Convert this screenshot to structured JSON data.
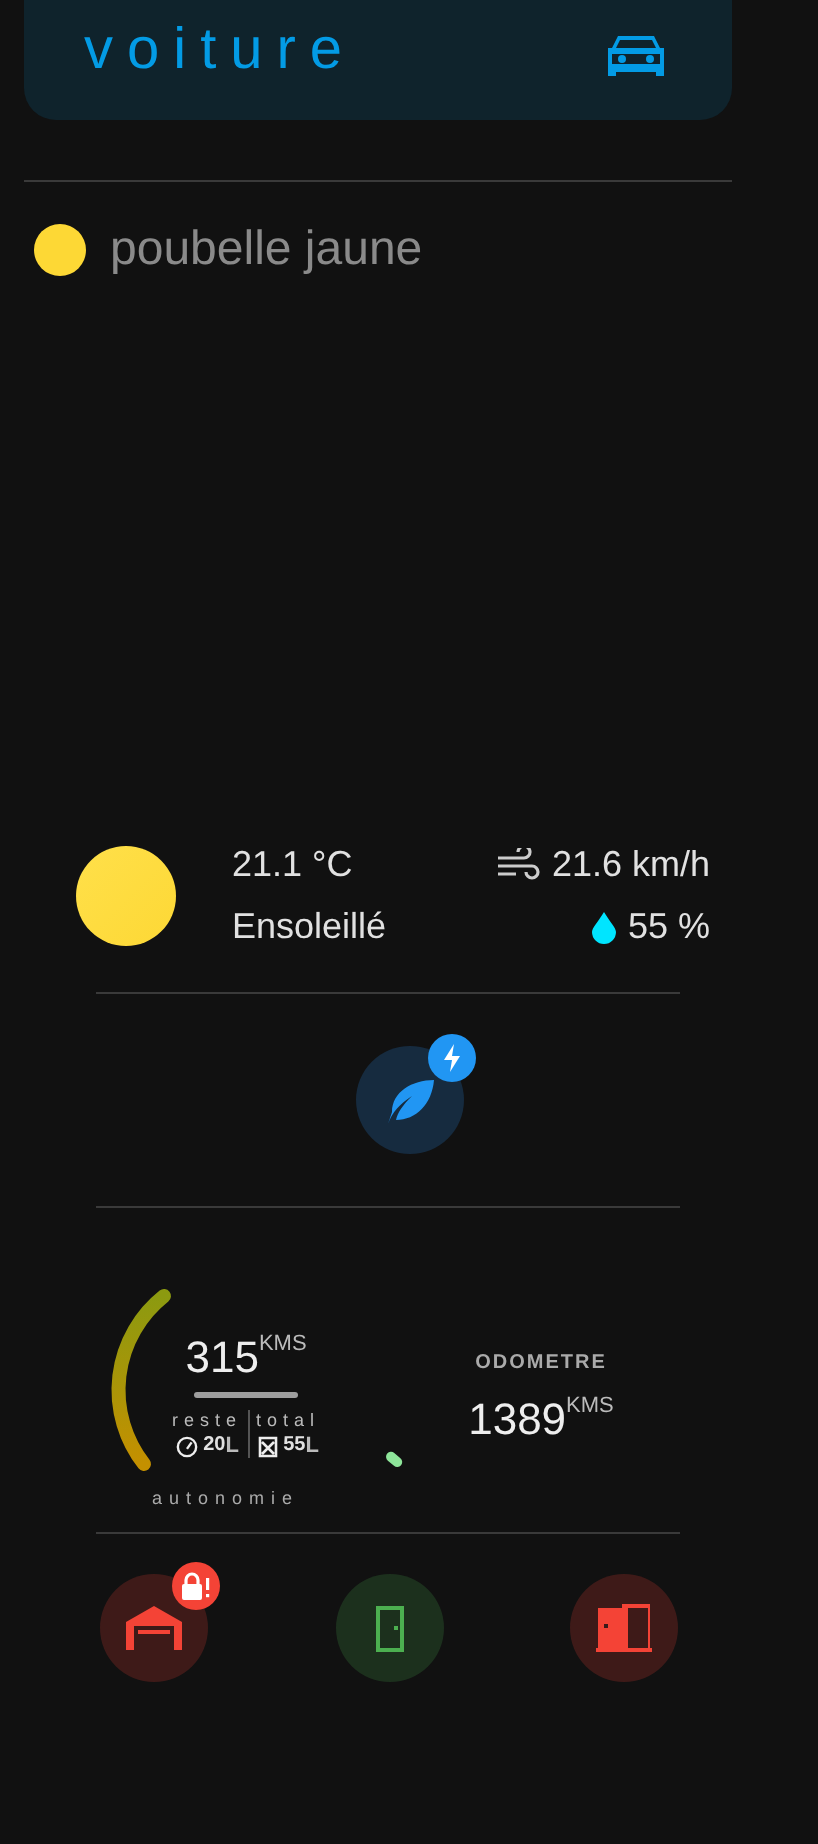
{
  "header": {
    "title": "voiture"
  },
  "reminders": [
    {
      "label": "poubelle jaune",
      "color": "#fdd835"
    }
  ],
  "weather": {
    "temperature": "21.1 °C",
    "condition": "Ensoleillé",
    "wind": "21.6 km/h",
    "humidity": "55 %"
  },
  "eco_button": {
    "badge": true
  },
  "fuel": {
    "value": "315",
    "unit": "KMS",
    "left_label": "reste",
    "right_label": "total",
    "left_value": "20",
    "left_unit": "L",
    "right_value": "55",
    "right_unit": "L",
    "caption": "autonomie"
  },
  "odometer": {
    "label": "ODOMETRE",
    "value": "1389",
    "unit": "KMS"
  },
  "doors": [
    {
      "kind": "garage",
      "color": "#f44336",
      "alert": true
    },
    {
      "kind": "door",
      "color": "#4caf50",
      "alert": false
    },
    {
      "kind": "door-open",
      "color": "#f44336",
      "alert": false
    }
  ]
}
